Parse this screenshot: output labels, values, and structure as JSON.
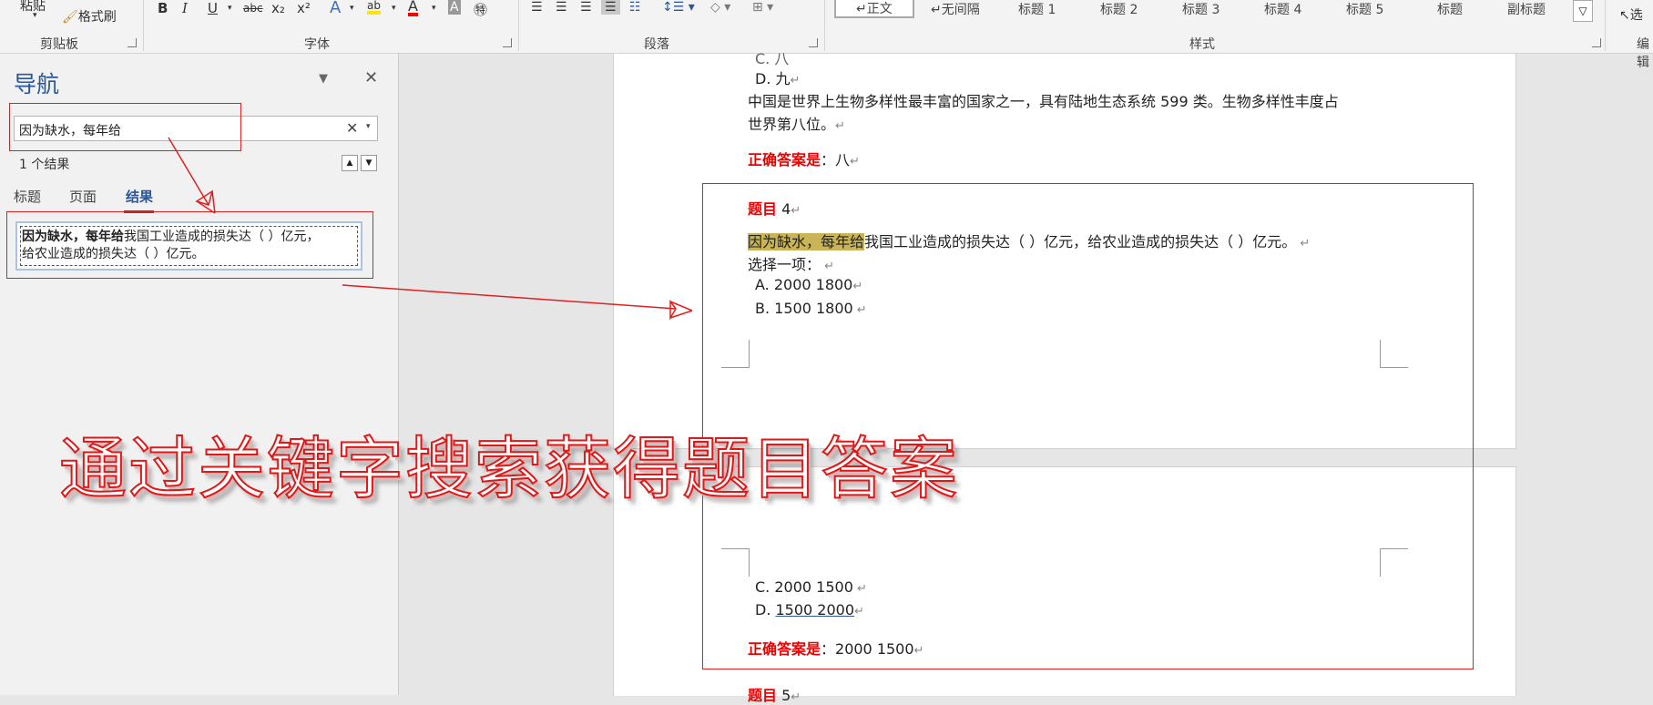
{
  "ribbon": {
    "paste": "粘贴",
    "format_painter": "格式刷",
    "groups": {
      "clipboard": "剪贴板",
      "font": "字体",
      "paragraph": "段落",
      "styles": "样式",
      "edit": "编辑"
    },
    "font_buttons": [
      "B",
      "I",
      "U",
      "abc",
      "x₂",
      "x²",
      "A",
      "ab",
      "A",
      "A",
      "㊕"
    ],
    "styles": [
      "↵正文",
      "↵无间隔",
      "标题 1",
      "标题 2",
      "标题 3",
      "标题 4",
      "标题 5",
      "标题",
      "副标题"
    ],
    "select": "选"
  },
  "nav": {
    "title": "导航",
    "search_value": "因为缺水，每年给",
    "result_count": "1 个结果",
    "tabs": [
      "标题",
      "页面",
      "结果"
    ],
    "result_bold": "因为缺水，每年给",
    "result_rest1": "我国工业造成的损失达（    ）亿元，",
    "result_line2": "给农业造成的损失达（    ）亿元。"
  },
  "doc": {
    "prev_option_c": "C. 八",
    "prev_option_d": "D.  九",
    "fact_line1": "中国是世界上生物多样性最丰富的国家之一，具有陆地生态系统 599 类。生物多样性丰度占",
    "fact_line2": "世界第八位。",
    "answer_label": "正确答案是",
    "answer_prev": "：八",
    "q4_label": "题目",
    "q4_num": " 4",
    "q4_highlight": "因为缺水，每年给",
    "q4_rest": "我国工业造成的损失达（        ）亿元，给农业造成的损失达（        ）亿元。",
    "choose": "选择一项：",
    "option_a": "A. 2000 1800",
    "option_b": "B. 1500 1800",
    "option_c": "C. 2000 1500",
    "option_d_prefix": "D. ",
    "option_d_value": "1500    2000",
    "answer_q4": "：2000 1500",
    "q5_label": "题目",
    "q5_num": " 5"
  },
  "watermark": "通过关键字搜索获得题目答案",
  "colors": {
    "accent": "#2b579a",
    "annotation": "#e02020",
    "highlight": "#c9b458"
  }
}
